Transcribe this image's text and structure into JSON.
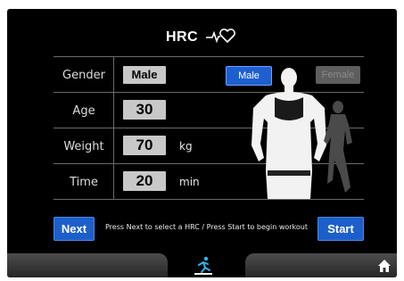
{
  "header": {
    "title": "HRC",
    "title_icon": "heart-pulse-icon"
  },
  "form": {
    "rows": [
      {
        "label": "Gender",
        "value": "Male",
        "unit": ""
      },
      {
        "label": "Age",
        "value": "30",
        "unit": ""
      },
      {
        "label": "Weight",
        "value": "70",
        "unit": "kg"
      },
      {
        "label": "Time",
        "value": "20",
        "unit": "min"
      }
    ]
  },
  "gender_toggle": {
    "male_label": "Male",
    "female_label": "Female",
    "selected": "Male"
  },
  "footer": {
    "next_label": "Next",
    "hint": "Press Next to select a HRC  /  Press Start to begin workout",
    "start_label": "Start"
  },
  "nav": {
    "center_icon": "treadmill-runner-icon",
    "home_icon": "home-icon"
  },
  "colors": {
    "accent": "#1d5fca",
    "background": "#000000",
    "value_box": "#c8c8c8"
  }
}
